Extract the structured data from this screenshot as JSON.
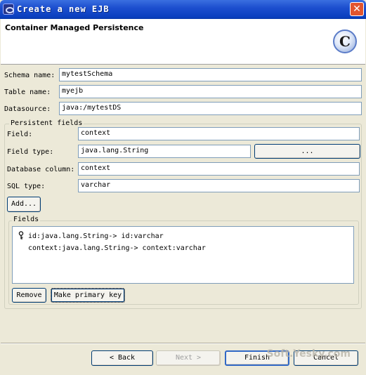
{
  "window": {
    "title": "Create a new EJB",
    "close_label": "✕"
  },
  "header": {
    "title": "Container Managed Persistence",
    "logo_letter": "C"
  },
  "form": {
    "schema_label": "Schema name:",
    "schema_value": "mytestSchema",
    "table_label": "Table name:",
    "table_value": "myejb",
    "datasource_label": "Datasource:",
    "datasource_value": "java:/mytestDS"
  },
  "persistent": {
    "group_label": "Persistent fields",
    "field_label": "Field:",
    "field_value": "context",
    "type_label": "Field type:",
    "type_value": "java.lang.String",
    "browse_label": "...",
    "column_label": "Database column:",
    "column_value": "context",
    "sql_label": "SQL type:",
    "sql_value": "varchar",
    "add_label": "Add..."
  },
  "fields": {
    "group_label": "Fields",
    "items": [
      {
        "text": "id:java.lang.String-> id:varchar",
        "primary": true
      },
      {
        "text": "context:java.lang.String-> context:varchar",
        "primary": false
      }
    ],
    "remove_label": "Remove",
    "primary_key_label": "Make primary key"
  },
  "footer": {
    "back_label": "< Back",
    "next_label": "Next >",
    "finish_label": "Finish",
    "cancel_label": "Cancel"
  },
  "watermark": "Soft.Yesky.com"
}
